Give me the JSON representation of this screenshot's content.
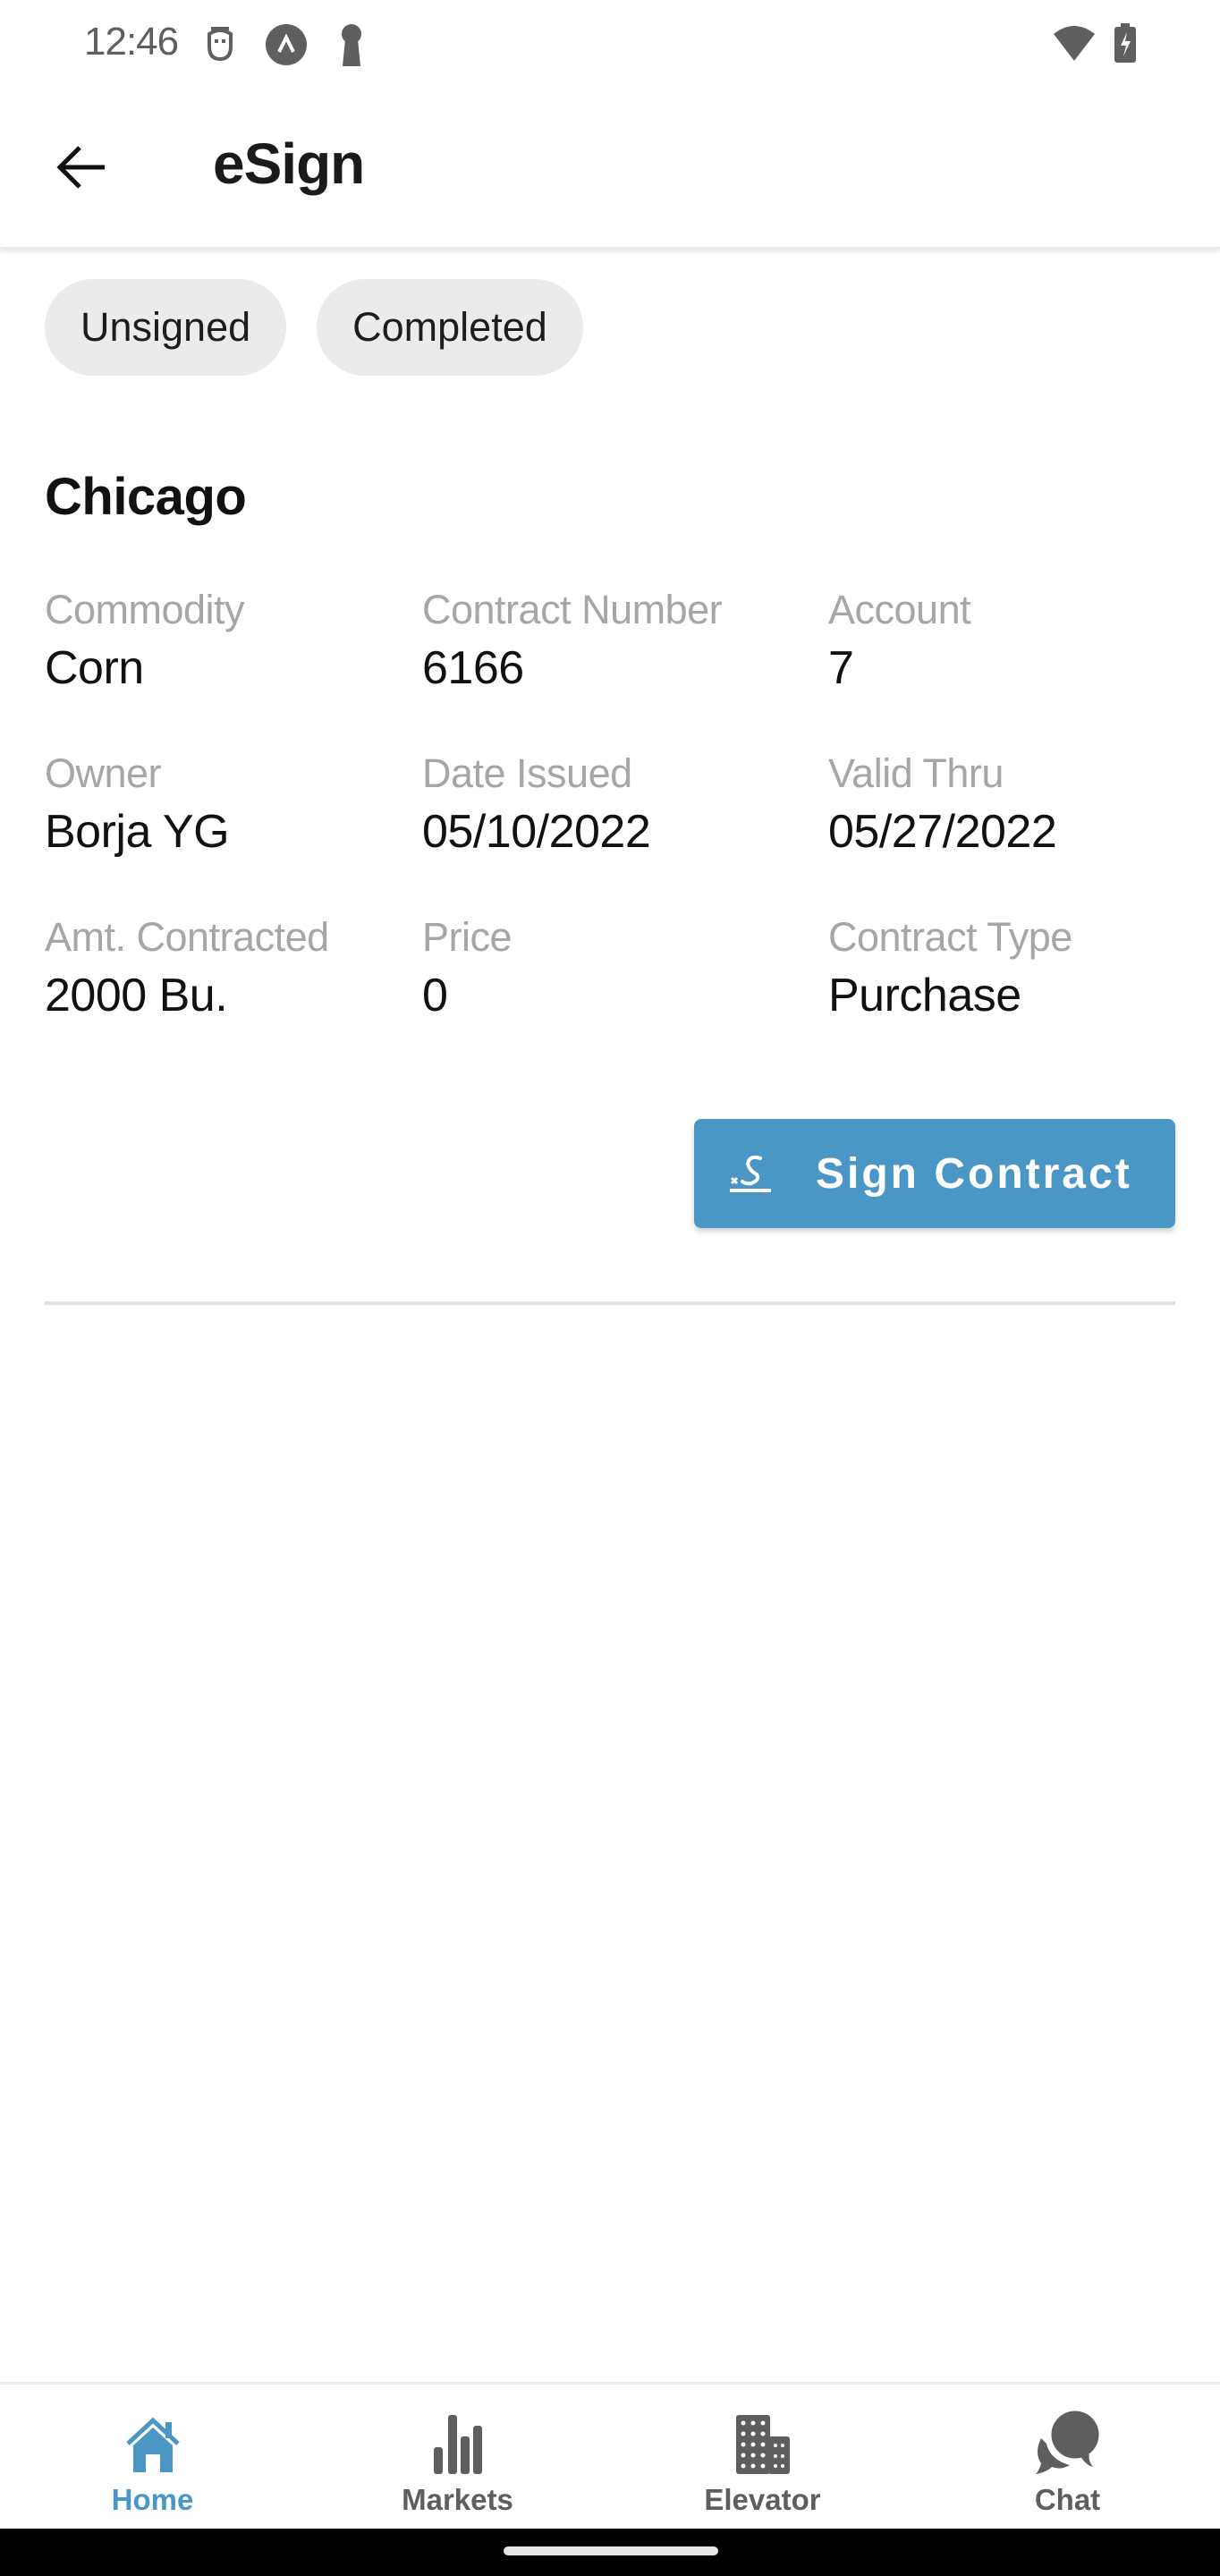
{
  "status_bar": {
    "time": "12:46",
    "left_icons": [
      "notification-app-icon",
      "app-badge-icon",
      "keyhole-icon"
    ],
    "right_icons": [
      "wifi-icon",
      "battery-charging-icon"
    ]
  },
  "app_bar": {
    "back_icon": "arrow-left-icon",
    "title": "eSign"
  },
  "filters": [
    {
      "label": "Unsigned",
      "selected": false
    },
    {
      "label": "Completed",
      "selected": false
    }
  ],
  "contract": {
    "location": "Chicago",
    "fields": [
      {
        "label": "Commodity",
        "value": "Corn"
      },
      {
        "label": "Contract Number",
        "value": "6166"
      },
      {
        "label": "Account",
        "value": "7"
      },
      {
        "label": "Owner",
        "value": "Borja YG"
      },
      {
        "label": "Date Issued",
        "value": "05/10/2022"
      },
      {
        "label": "Valid Thru",
        "value": "05/27/2022"
      },
      {
        "label": "Amt. Contracted",
        "value": "2000 Bu."
      },
      {
        "label": "Price",
        "value": "0"
      },
      {
        "label": "Contract Type",
        "value": "Purchase"
      }
    ],
    "sign_button": {
      "label": "Sign Contract",
      "icon": "signature-icon"
    }
  },
  "bottom_nav": {
    "active": "Home",
    "items": [
      {
        "label": "Home",
        "icon": "home-icon"
      },
      {
        "label": "Markets",
        "icon": "bar-chart-icon"
      },
      {
        "label": "Elevator",
        "icon": "building-icon"
      },
      {
        "label": "Chat",
        "icon": "chat-bubbles-icon"
      }
    ]
  },
  "colors": {
    "accent": "#4a96c5",
    "chip_bg": "#ebebeb",
    "label_gray": "#a6a6a6",
    "nav_inactive": "#5e5e5e"
  }
}
